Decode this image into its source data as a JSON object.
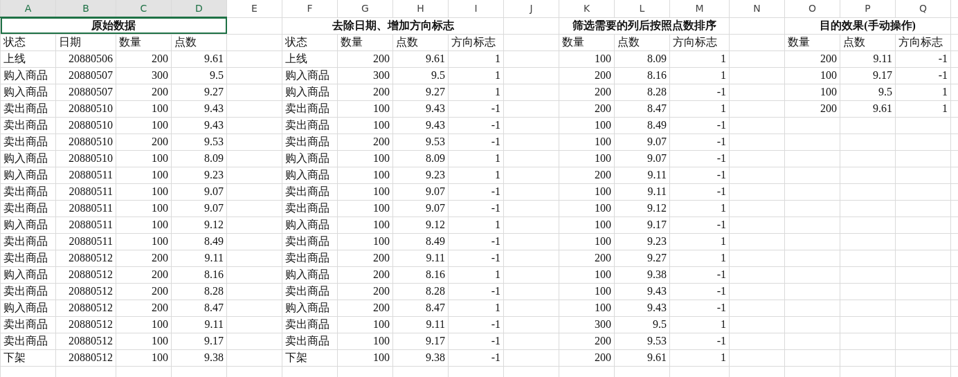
{
  "column_headers": [
    {
      "label": "A",
      "selected": true
    },
    {
      "label": "B",
      "selected": true
    },
    {
      "label": "C",
      "selected": true
    },
    {
      "label": "D",
      "selected": true
    },
    {
      "label": "E",
      "selected": false
    },
    {
      "label": "F",
      "selected": false
    },
    {
      "label": "G",
      "selected": false
    },
    {
      "label": "H",
      "selected": false
    },
    {
      "label": "I",
      "selected": false
    },
    {
      "label": "J",
      "selected": false
    },
    {
      "label": "K",
      "selected": false
    },
    {
      "label": "L",
      "selected": false
    },
    {
      "label": "M",
      "selected": false
    },
    {
      "label": "N",
      "selected": false
    },
    {
      "label": "O",
      "selected": false
    },
    {
      "label": "P",
      "selected": false
    },
    {
      "label": "Q",
      "selected": false
    }
  ],
  "merged_titles": [
    {
      "text": "原始数据",
      "selected": true
    },
    {
      "text": "去除日期、增加方向标志",
      "selected": false
    },
    {
      "text": "筛选需要的列后按照点数排序",
      "selected": false
    },
    {
      "text": "目的效果(手动操作)",
      "selected": false
    }
  ],
  "rows": [
    [
      "状态",
      "日期",
      "数量",
      "点数",
      null,
      "状态",
      "数量",
      "点数",
      "方向标志",
      null,
      "数量",
      "点数",
      "方向标志",
      null,
      "数量",
      "点数",
      "方向标志"
    ],
    [
      "上线",
      "20880506",
      "200",
      "9.61",
      null,
      "上线",
      "200",
      "9.61",
      "1",
      null,
      "100",
      "8.09",
      "1",
      null,
      "200",
      "9.11",
      "-1"
    ],
    [
      "购入商品",
      "20880507",
      "300",
      "9.5",
      null,
      "购入商品",
      "300",
      "9.5",
      "1",
      null,
      "200",
      "8.16",
      "1",
      null,
      "100",
      "9.17",
      "-1"
    ],
    [
      "购入商品",
      "20880507",
      "200",
      "9.27",
      null,
      "购入商品",
      "200",
      "9.27",
      "1",
      null,
      "200",
      "8.28",
      "-1",
      null,
      "100",
      "9.5",
      "1"
    ],
    [
      "卖出商品",
      "20880510",
      "100",
      "9.43",
      null,
      "卖出商品",
      "100",
      "9.43",
      "-1",
      null,
      "200",
      "8.47",
      "1",
      null,
      "200",
      "9.61",
      "1"
    ],
    [
      "卖出商品",
      "20880510",
      "100",
      "9.43",
      null,
      "卖出商品",
      "100",
      "9.43",
      "-1",
      null,
      "100",
      "8.49",
      "-1",
      null,
      null,
      null,
      null
    ],
    [
      "卖出商品",
      "20880510",
      "200",
      "9.53",
      null,
      "卖出商品",
      "200",
      "9.53",
      "-1",
      null,
      "100",
      "9.07",
      "-1",
      null,
      null,
      null,
      null
    ],
    [
      "购入商品",
      "20880510",
      "100",
      "8.09",
      null,
      "购入商品",
      "100",
      "8.09",
      "1",
      null,
      "100",
      "9.07",
      "-1",
      null,
      null,
      null,
      null
    ],
    [
      "购入商品",
      "20880511",
      "100",
      "9.23",
      null,
      "购入商品",
      "100",
      "9.23",
      "1",
      null,
      "200",
      "9.11",
      "-1",
      null,
      null,
      null,
      null
    ],
    [
      "卖出商品",
      "20880511",
      "100",
      "9.07",
      null,
      "卖出商品",
      "100",
      "9.07",
      "-1",
      null,
      "100",
      "9.11",
      "-1",
      null,
      null,
      null,
      null
    ],
    [
      "卖出商品",
      "20880511",
      "100",
      "9.07",
      null,
      "卖出商品",
      "100",
      "9.07",
      "-1",
      null,
      "100",
      "9.12",
      "1",
      null,
      null,
      null,
      null
    ],
    [
      "购入商品",
      "20880511",
      "100",
      "9.12",
      null,
      "购入商品",
      "100",
      "9.12",
      "1",
      null,
      "100",
      "9.17",
      "-1",
      null,
      null,
      null,
      null
    ],
    [
      "卖出商品",
      "20880511",
      "100",
      "8.49",
      null,
      "卖出商品",
      "100",
      "8.49",
      "-1",
      null,
      "100",
      "9.23",
      "1",
      null,
      null,
      null,
      null
    ],
    [
      "卖出商品",
      "20880512",
      "200",
      "9.11",
      null,
      "卖出商品",
      "200",
      "9.11",
      "-1",
      null,
      "200",
      "9.27",
      "1",
      null,
      null,
      null,
      null
    ],
    [
      "购入商品",
      "20880512",
      "200",
      "8.16",
      null,
      "购入商品",
      "200",
      "8.16",
      "1",
      null,
      "100",
      "9.38",
      "-1",
      null,
      null,
      null,
      null
    ],
    [
      "卖出商品",
      "20880512",
      "200",
      "8.28",
      null,
      "卖出商品",
      "200",
      "8.28",
      "-1",
      null,
      "100",
      "9.43",
      "-1",
      null,
      null,
      null,
      null
    ],
    [
      "购入商品",
      "20880512",
      "200",
      "8.47",
      null,
      "购入商品",
      "200",
      "8.47",
      "1",
      null,
      "100",
      "9.43",
      "-1",
      null,
      null,
      null,
      null
    ],
    [
      "卖出商品",
      "20880512",
      "100",
      "9.11",
      null,
      "卖出商品",
      "100",
      "9.11",
      "-1",
      null,
      "300",
      "9.5",
      "1",
      null,
      null,
      null,
      null
    ],
    [
      "卖出商品",
      "20880512",
      "100",
      "9.17",
      null,
      "卖出商品",
      "100",
      "9.17",
      "-1",
      null,
      "200",
      "9.53",
      "-1",
      null,
      null,
      null,
      null
    ],
    [
      "下架",
      "20880512",
      "100",
      "9.38",
      null,
      "下架",
      "100",
      "9.38",
      "-1",
      null,
      "200",
      "9.61",
      "1",
      null,
      null,
      null,
      null
    ]
  ]
}
